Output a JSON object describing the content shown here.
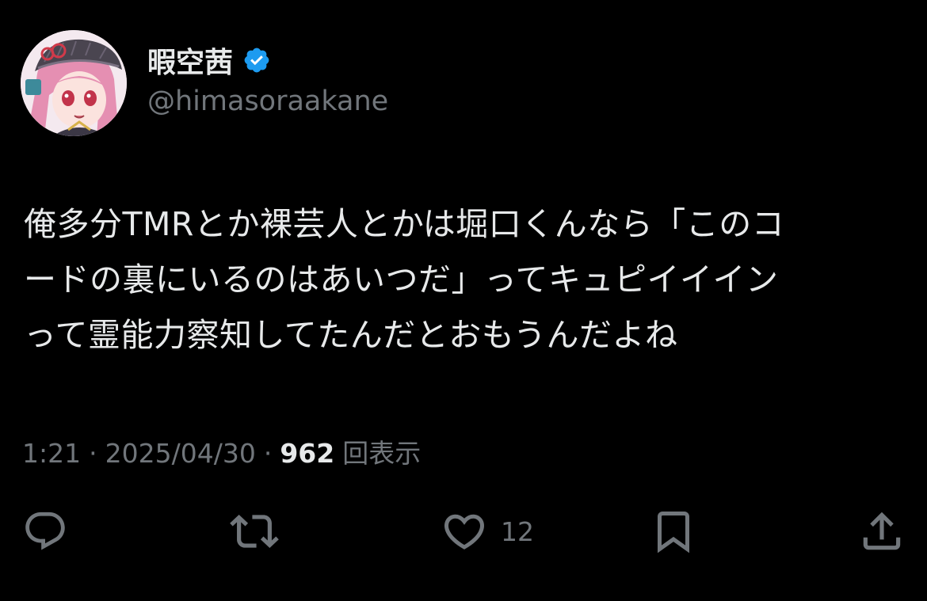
{
  "author": {
    "display_name": "暇空茜",
    "handle": "@himasoraakane",
    "verified": true,
    "verified_color": "#1d9bf0",
    "avatar_icon": "anime-avatar-icon"
  },
  "tweet": {
    "lines": [
      "俺多分TMRとか裸芸人とかは堀口くんなら「このコ",
      "ードの裏にいるのはあいつだ」ってキュピイイイン",
      "って霊能力察知してたんだとおもうんだよね"
    ]
  },
  "meta": {
    "time": "1:21",
    "separator": "·",
    "date": "2025/04/30",
    "views_count": "962",
    "views_label": "回表示"
  },
  "actions": {
    "reply_icon": "reply-icon",
    "retweet_icon": "retweet-icon",
    "like_icon": "heart-icon",
    "like_count": "12",
    "bookmark_icon": "bookmark-icon",
    "share_icon": "share-icon",
    "icon_color": "#71767b"
  },
  "colors": {
    "background": "#000000",
    "text_primary": "#e7e9ea",
    "text_secondary": "#71767b"
  }
}
